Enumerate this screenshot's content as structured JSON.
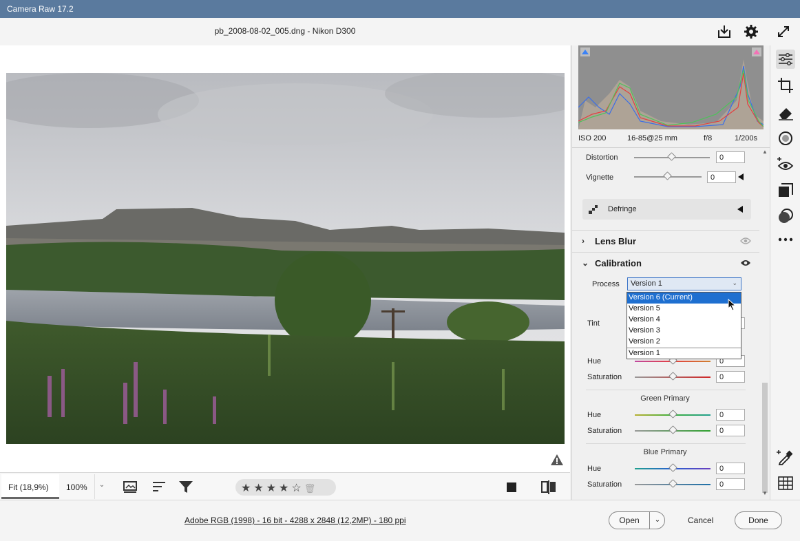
{
  "window": {
    "title": "Camera Raw 17.2"
  },
  "header": {
    "filename": "pb_2008-08-02_005.dng  -  Nikon D300",
    "icons": [
      "save-download-icon",
      "gear-icon",
      "fullscreen-icon"
    ]
  },
  "histogram": {
    "iso": "ISO 200",
    "lens": "16-85@25 mm",
    "aperture": "f/8",
    "shutter": "1/200s",
    "colors": {
      "red": "#e34040",
      "green": "#4ec25a",
      "blue": "#3a6ee8",
      "shadow_clip": "#3b82f6",
      "highlight_clip": "#f472b6"
    }
  },
  "optics": {
    "distortion": {
      "label": "Distortion",
      "value": "0"
    },
    "vignette": {
      "label": "Vignette",
      "value": "0"
    },
    "defringe_label": "Defringe"
  },
  "sections": {
    "lens_blur": "Lens Blur",
    "calibration": "Calibration"
  },
  "calibration": {
    "process_label": "Process",
    "process_value": "Version 1",
    "process_options": [
      "Version 6 (Current)",
      "Version 5",
      "Version 4",
      "Version 3",
      "Version 2",
      "Version 1"
    ],
    "highlighted_option": "Version 6 (Current)",
    "tint_label": "Tint",
    "red_primary": {
      "hue_label": "Hue",
      "hue_value": "0",
      "sat_label": "Saturation",
      "sat_value": "0"
    },
    "green_primary": {
      "title": "Green Primary",
      "hue_label": "Hue",
      "hue_value": "0",
      "sat_label": "Saturation",
      "sat_value": "0"
    },
    "blue_primary": {
      "title": "Blue Primary",
      "hue_label": "Hue",
      "hue_value": "0",
      "sat_label": "Saturation",
      "sat_value": "0"
    }
  },
  "bottombar": {
    "zoom_fit": "Fit (18,9%)",
    "zoom_100": "100%",
    "rating_stars": 4,
    "rating_max": 5
  },
  "footer": {
    "info": "Adobe RGB (1998) - 16 bit - 4288 x 2848 (12,2MP) - 180 ppi",
    "open": "Open",
    "cancel": "Cancel",
    "done": "Done"
  },
  "tools": [
    "edit-sliders-icon",
    "crop-icon",
    "eraser-icon",
    "mask-icon",
    "red-eye-icon",
    "presets-icon",
    "snapshots-icon",
    "more-icon",
    "color-sampler-icon",
    "grid-icon"
  ]
}
